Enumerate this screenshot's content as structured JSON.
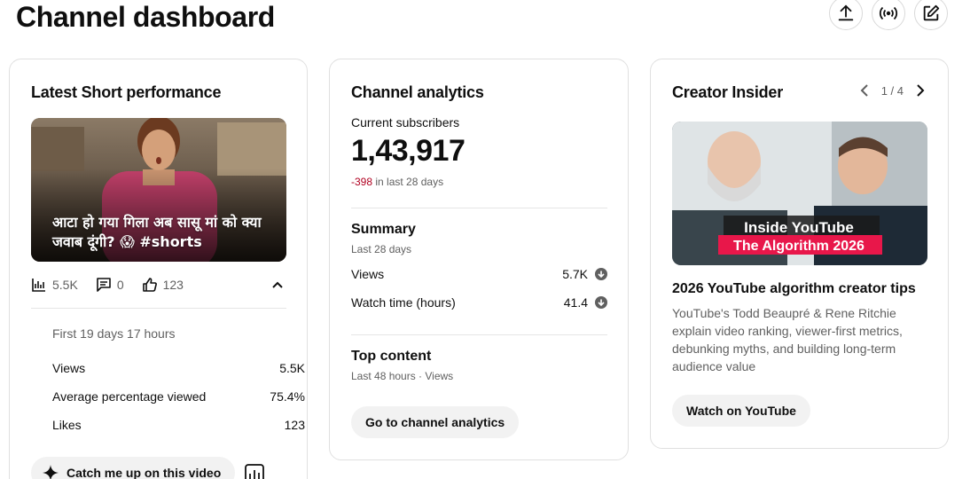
{
  "page": {
    "title": "Channel dashboard"
  },
  "top_actions": [
    {
      "name": "upload-icon"
    },
    {
      "name": "go-live-icon"
    },
    {
      "name": "create-post-icon"
    }
  ],
  "short_card": {
    "title": "Latest Short performance",
    "thumbnail_caption": "आटा हो गया गिला अब सासू मां को क्या जवाब दूंगी? 😱 #shorts",
    "views": "5.5K",
    "comments": "0",
    "likes": "123",
    "period": "First 19 days 17 hours",
    "metrics": [
      {
        "label": "Views",
        "value": "5.5K"
      },
      {
        "label": "Average percentage viewed",
        "value": "75.4%"
      },
      {
        "label": "Likes",
        "value": "123"
      }
    ],
    "catch_up_label": "Catch me up on this video"
  },
  "analytics_card": {
    "title": "Channel analytics",
    "subscribers_label": "Current subscribers",
    "subscribers_value": "1,43,917",
    "subscribers_delta": "-398",
    "subscribers_delta_period": "in last 28 days",
    "summary_title": "Summary",
    "summary_period": "Last 28 days",
    "summary_rows": [
      {
        "label": "Views",
        "value": "5.7K"
      },
      {
        "label": "Watch time (hours)",
        "value": "41.4"
      }
    ],
    "top_content_title": "Top content",
    "top_content_period": "Last 48 hours · Views",
    "go_button": "Go to channel analytics"
  },
  "insider_card": {
    "title": "Creator Insider",
    "pager": "1 / 4",
    "thumbnail_line1": "Inside YouTube",
    "thumbnail_line2": "The Algorithm 2026",
    "video_title": "2026 YouTube algorithm creator tips",
    "description": "YouTube's Todd Beaupré & Rene Ritchie explain video ranking, viewer-first metrics, debunking myths, and building long-term audience value",
    "watch_button": "Watch on YouTube"
  },
  "colors": {
    "negative": "#b00020",
    "button_bg": "#f2f2f2",
    "border": "#e0e0e0"
  }
}
